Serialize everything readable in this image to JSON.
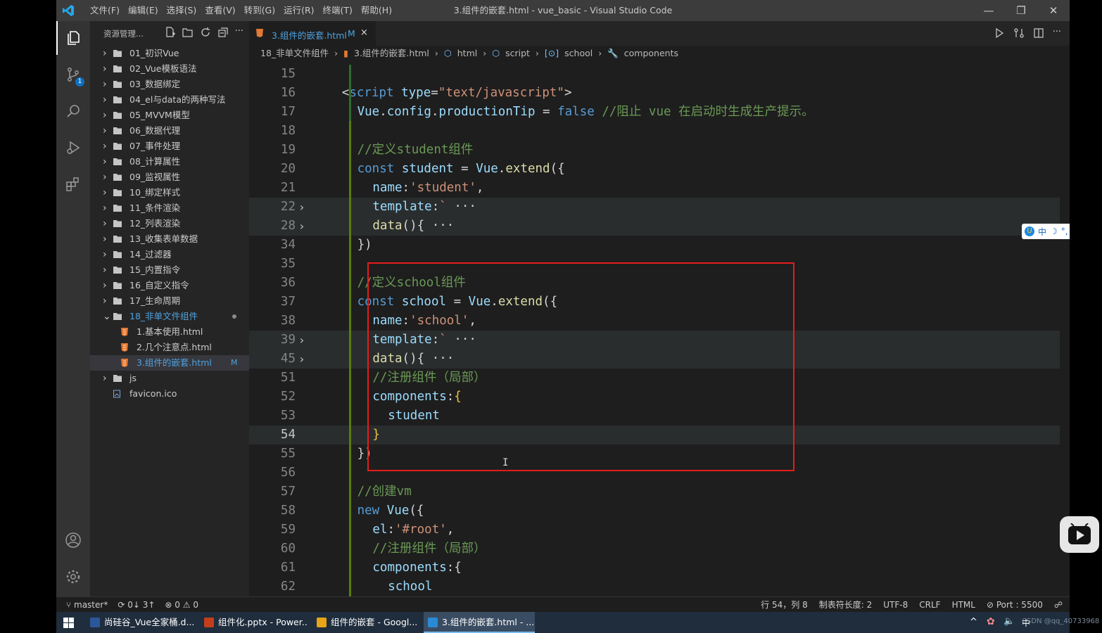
{
  "window": {
    "title": "3.组件的嵌套.html - vue_basic - Visual Studio Code",
    "menu": [
      "文件(F)",
      "编辑(E)",
      "选择(S)",
      "查看(V)",
      "转到(G)",
      "运行(R)",
      "终端(T)",
      "帮助(H)"
    ],
    "controls": {
      "minimize": "—",
      "restore": "❐",
      "close": "✕"
    }
  },
  "activity": {
    "scm_badge": "1"
  },
  "sidebar": {
    "title": "资源管理...",
    "tree": [
      {
        "label": "01_初识Vue",
        "type": "folder"
      },
      {
        "label": "02_Vue模板语法",
        "type": "folder"
      },
      {
        "label": "03_数据绑定",
        "type": "folder"
      },
      {
        "label": "04_el与data的两种写法",
        "type": "folder"
      },
      {
        "label": "05_MVVM模型",
        "type": "folder"
      },
      {
        "label": "06_数据代理",
        "type": "folder"
      },
      {
        "label": "07_事件处理",
        "type": "folder"
      },
      {
        "label": "08_计算属性",
        "type": "folder"
      },
      {
        "label": "09_监视属性",
        "type": "folder"
      },
      {
        "label": "10_绑定样式",
        "type": "folder"
      },
      {
        "label": "11_条件渲染",
        "type": "folder"
      },
      {
        "label": "12_列表渲染",
        "type": "folder"
      },
      {
        "label": "13_收集表单数据",
        "type": "folder"
      },
      {
        "label": "14_过滤器",
        "type": "folder"
      },
      {
        "label": "15_内置指令",
        "type": "folder"
      },
      {
        "label": "16_自定义指令",
        "type": "folder"
      },
      {
        "label": "17_生命周期",
        "type": "folder"
      },
      {
        "label": "18_非单文件组件",
        "type": "folder-open"
      },
      {
        "label": "1.基本使用.html",
        "type": "html"
      },
      {
        "label": "2.几个注意点.html",
        "type": "html"
      },
      {
        "label": "3.组件的嵌套.html",
        "type": "html",
        "modified": "M"
      },
      {
        "label": "js",
        "type": "folder"
      },
      {
        "label": "favicon.ico",
        "type": "file"
      }
    ]
  },
  "editor": {
    "tab": {
      "label": "3.组件的嵌套.html",
      "modified": "M",
      "close": "×"
    },
    "breadcrumbs": [
      "18_非单文件组件",
      "3.组件的嵌套.html",
      "html",
      "script",
      "school",
      "components"
    ],
    "lines": [
      {
        "n": "15",
        "indent": 0,
        "tokens": []
      },
      {
        "n": "16",
        "indent": 1,
        "tokens": [
          [
            "p",
            "<"
          ],
          [
            "k",
            "script "
          ],
          [
            "v",
            "type"
          ],
          [
            "p",
            "="
          ],
          [
            "s",
            "\"text/javascript\""
          ],
          [
            "p",
            ">"
          ]
        ]
      },
      {
        "n": "17",
        "indent": 2,
        "tokens": [
          [
            "v",
            "Vue"
          ],
          [
            "p",
            "."
          ],
          [
            "v",
            "config"
          ],
          [
            "p",
            "."
          ],
          [
            "v",
            "productionTip "
          ],
          [
            "p",
            "= "
          ],
          [
            "k",
            "false "
          ],
          [
            "c",
            "//阻止 vue 在启动时生成生产提示。"
          ]
        ]
      },
      {
        "n": "18",
        "indent": 0,
        "tokens": []
      },
      {
        "n": "19",
        "indent": 2,
        "tokens": [
          [
            "c",
            "//定义student组件"
          ]
        ]
      },
      {
        "n": "20",
        "indent": 2,
        "tokens": [
          [
            "k",
            "const "
          ],
          [
            "v",
            "student "
          ],
          [
            "p",
            "= "
          ],
          [
            "v",
            "Vue"
          ],
          [
            "p",
            "."
          ],
          [
            "kw",
            "extend"
          ],
          [
            "p",
            "({"
          ]
        ]
      },
      {
        "n": "21",
        "indent": 3,
        "tokens": [
          [
            "v",
            "name"
          ],
          [
            "p",
            ":"
          ],
          [
            "s",
            "'student'"
          ],
          [
            "p",
            ","
          ]
        ]
      },
      {
        "n": "22",
        "indent": 3,
        "tokens": [
          [
            "v",
            "template"
          ],
          [
            "p",
            ":"
          ],
          [
            "s",
            "`"
          ],
          [
            "p",
            " ···"
          ]
        ],
        "fold": true,
        "hl": true
      },
      {
        "n": "28",
        "indent": 3,
        "tokens": [
          [
            "kw",
            "data"
          ],
          [
            "p",
            "(){ ···"
          ]
        ],
        "fold": true,
        "hl": true
      },
      {
        "n": "34",
        "indent": 2,
        "tokens": [
          [
            "p",
            "})"
          ]
        ]
      },
      {
        "n": "35",
        "indent": 0,
        "tokens": []
      },
      {
        "n": "36",
        "indent": 2,
        "tokens": [
          [
            "c",
            "//定义school组件"
          ]
        ]
      },
      {
        "n": "37",
        "indent": 2,
        "tokens": [
          [
            "k",
            "const "
          ],
          [
            "v",
            "school "
          ],
          [
            "p",
            "= "
          ],
          [
            "v",
            "Vue"
          ],
          [
            "p",
            "."
          ],
          [
            "kw",
            "extend"
          ],
          [
            "p",
            "({"
          ]
        ]
      },
      {
        "n": "38",
        "indent": 3,
        "tokens": [
          [
            "v",
            "name"
          ],
          [
            "p",
            ":"
          ],
          [
            "s",
            "'school'"
          ],
          [
            "p",
            ","
          ]
        ]
      },
      {
        "n": "39",
        "indent": 3,
        "tokens": [
          [
            "v",
            "template"
          ],
          [
            "p",
            ":"
          ],
          [
            "s",
            "`"
          ],
          [
            "p",
            " ···"
          ]
        ],
        "fold": true,
        "hl": true
      },
      {
        "n": "45",
        "indent": 3,
        "tokens": [
          [
            "kw",
            "data"
          ],
          [
            "p",
            "(){ ···"
          ]
        ],
        "fold": true,
        "hl": true
      },
      {
        "n": "51",
        "indent": 3,
        "tokens": [
          [
            "c",
            "//注册组件（局部）"
          ]
        ]
      },
      {
        "n": "52",
        "indent": 3,
        "tokens": [
          [
            "v",
            "components"
          ],
          [
            "p",
            ":"
          ],
          [
            "y",
            "{"
          ]
        ]
      },
      {
        "n": "53",
        "indent": 4,
        "tokens": [
          [
            "v",
            "student"
          ]
        ]
      },
      {
        "n": "54",
        "indent": 3,
        "tokens": [
          [
            "y",
            "}"
          ]
        ],
        "current": true,
        "hl": true
      },
      {
        "n": "55",
        "indent": 2,
        "tokens": [
          [
            "p",
            "})"
          ]
        ]
      },
      {
        "n": "56",
        "indent": 0,
        "tokens": []
      },
      {
        "n": "57",
        "indent": 2,
        "tokens": [
          [
            "c",
            "//创建vm"
          ]
        ]
      },
      {
        "n": "58",
        "indent": 2,
        "tokens": [
          [
            "k",
            "new "
          ],
          [
            "v",
            "Vue"
          ],
          [
            "p",
            "({"
          ]
        ]
      },
      {
        "n": "59",
        "indent": 3,
        "tokens": [
          [
            "v",
            "el"
          ],
          [
            "p",
            ":"
          ],
          [
            "s",
            "'#root'"
          ],
          [
            "p",
            ","
          ]
        ]
      },
      {
        "n": "60",
        "indent": 3,
        "tokens": [
          [
            "c",
            "//注册组件（局部）"
          ]
        ]
      },
      {
        "n": "61",
        "indent": 3,
        "tokens": [
          [
            "v",
            "components"
          ],
          [
            "p",
            ":{"
          ]
        ]
      },
      {
        "n": "62",
        "indent": 4,
        "tokens": [
          [
            "v",
            "school"
          ]
        ]
      }
    ]
  },
  "ime": {
    "items": [
      "中",
      "☽",
      "°,",
      "⌨",
      "👤",
      "🔧"
    ]
  },
  "status": {
    "branch": "master*",
    "sync": "0↓ 3↑",
    "problems": "0 ⚠ 0",
    "position": "行 54，列 8",
    "tabsize": "制表符长度: 2",
    "encoding": "UTF-8",
    "eol": "CRLF",
    "language": "HTML",
    "port": "Port : 5500"
  },
  "taskbar": {
    "items": [
      {
        "label": "尚硅谷_Vue全家桶.d...",
        "color": "#2b579a"
      },
      {
        "label": "组件化.pptx - Power...",
        "color": "#c43e1c"
      },
      {
        "label": "组件的嵌套 - Googl...",
        "color": "#e8a317"
      },
      {
        "label": "3.组件的嵌套.html - ...",
        "color": "#2a8ad4",
        "active": true
      }
    ],
    "tray": [
      "^",
      "中"
    ],
    "watermark": "CSDN @qq_40733968"
  }
}
